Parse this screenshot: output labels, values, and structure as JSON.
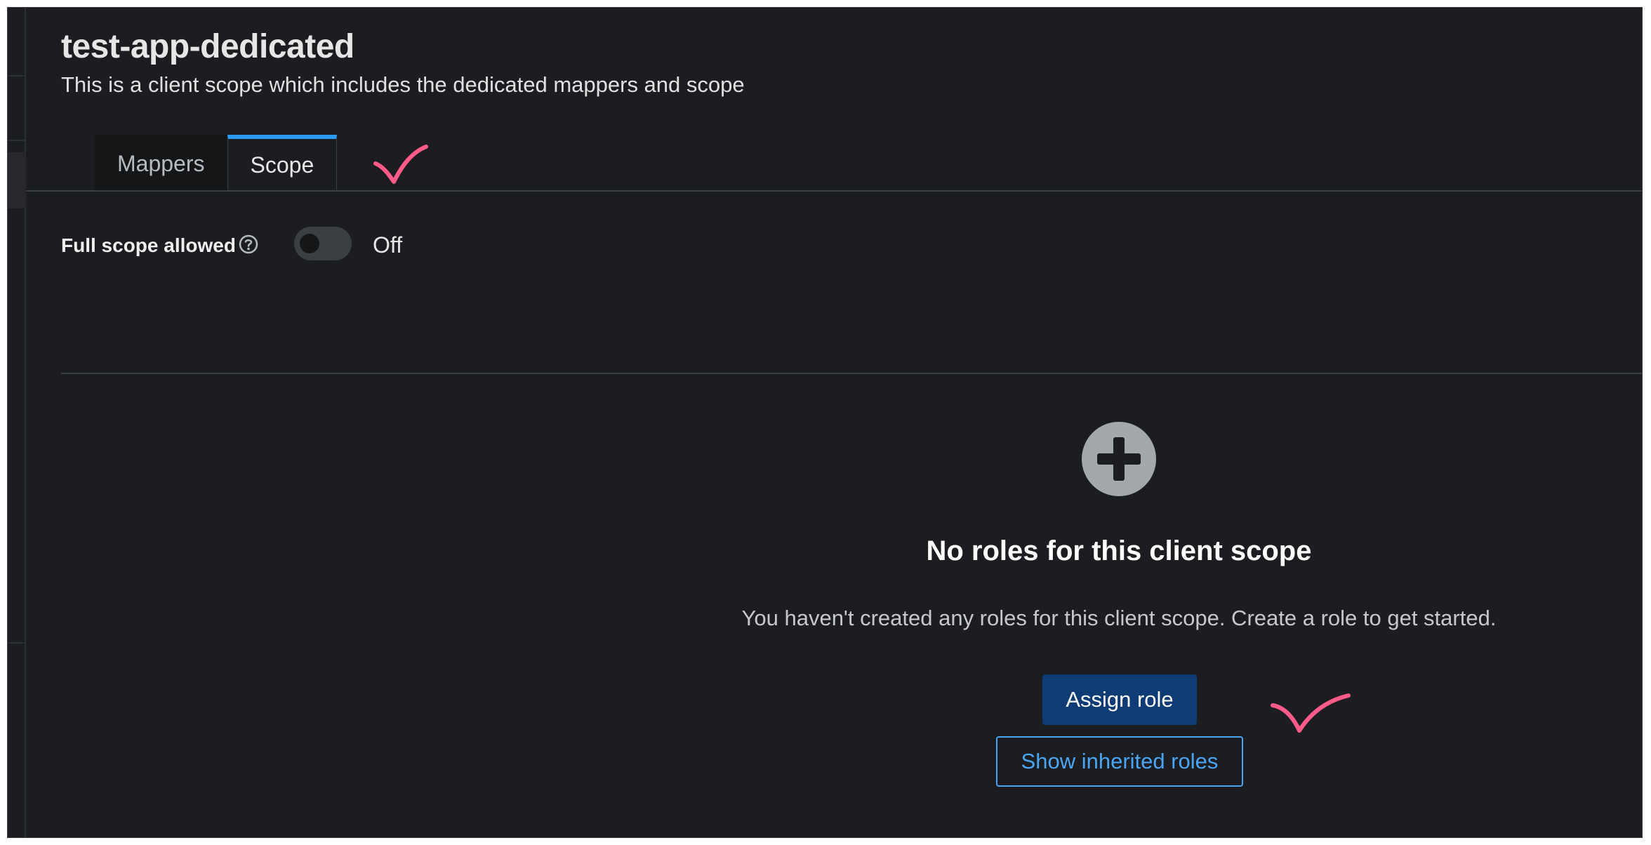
{
  "header": {
    "title": "test-app-dedicated",
    "subtitle": "This is a client scope which includes the dedicated mappers and scope"
  },
  "tabs": [
    {
      "label": "Mappers",
      "active": false
    },
    {
      "label": "Scope",
      "active": true
    }
  ],
  "full_scope": {
    "label": "Full scope allowed",
    "help_icon": "question-circle-icon",
    "state_label": "Off",
    "enabled": false
  },
  "empty_state": {
    "icon": "plus-circle-icon",
    "title": "No roles for this client scope",
    "body": "You haven't created any roles for this client scope. Create a role to get started.",
    "primary_button": "Assign role",
    "secondary_button": "Show inherited roles"
  },
  "colors": {
    "background": "#1b1d21",
    "tab_active_border": "#2b9af3",
    "primary_button": "#0f3c75",
    "link_blue": "#4aa6f5",
    "annotation_mark": "#ff5a8a"
  },
  "annotations": [
    "checkmark-icon",
    "checkmark-icon"
  ]
}
